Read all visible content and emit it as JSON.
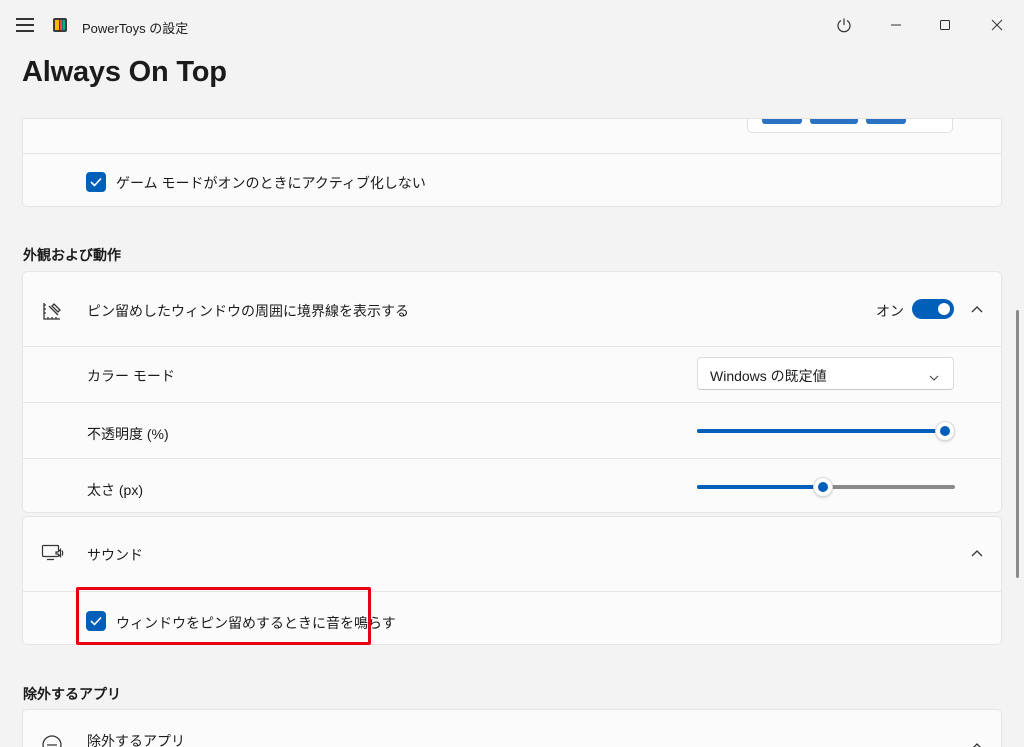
{
  "window": {
    "title": "PowerToys の設定",
    "icons": {
      "menu": "hamburger-icon",
      "logo": "powertoys-logo-icon",
      "power": "power-icon",
      "minimize": "minimize-icon",
      "maximize": "maximize-icon",
      "close": "close-icon"
    }
  },
  "page": {
    "title": "Always On Top"
  },
  "activation": {
    "game_mode_label": "ゲーム モードがオンのときにアクティブ化しない",
    "game_mode_checked": true
  },
  "appearance": {
    "section_title": "外観および動作",
    "border": {
      "label": "ピン留めしたウィンドウの周囲に境界線を表示する",
      "toggle_label": "オン",
      "toggle_on": true,
      "icon": "pin-border-icon"
    },
    "color_mode": {
      "label": "カラー モード",
      "value": "Windows の既定値"
    },
    "opacity": {
      "label": "不透明度 (%)",
      "value_fraction": 0.96
    },
    "thickness": {
      "label": "太さ (px)",
      "value_fraction": 0.49
    }
  },
  "sound": {
    "label": "サウンド",
    "icon": "sound-icon",
    "play_sound_label": "ウィンドウをピン留めするときに音を鳴らす",
    "play_sound_checked": true
  },
  "excluded": {
    "section_title": "除外するアプリ",
    "label": "除外するアプリ",
    "icon": "exclude-icon"
  },
  "colors": {
    "accent": "#005fb8",
    "highlight": "#e60012"
  }
}
